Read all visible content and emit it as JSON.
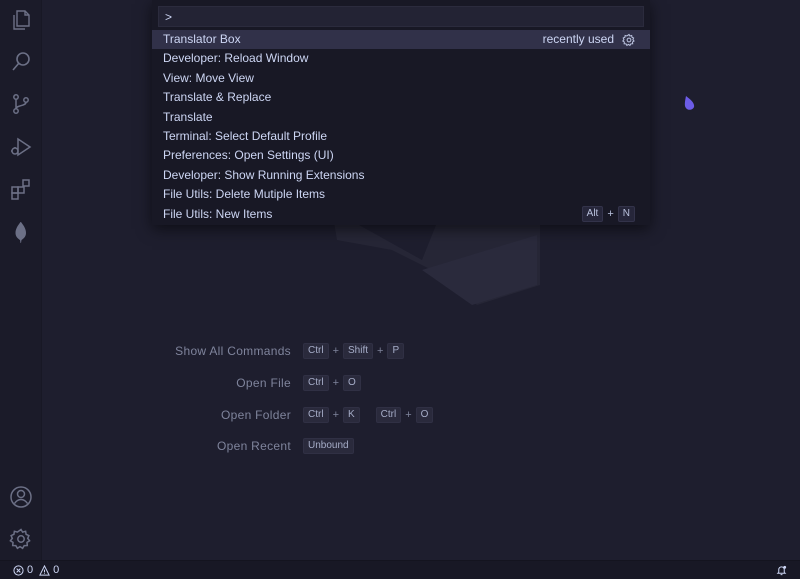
{
  "palette": {
    "input_value": ">",
    "items": [
      {
        "label": "Translator Box",
        "meta": "recently used",
        "selected": true
      },
      {
        "label": "Developer: Reload Window"
      },
      {
        "label": "View: Move View"
      },
      {
        "label": "Translate & Replace"
      },
      {
        "label": "Translate"
      },
      {
        "label": "Terminal: Select Default Profile"
      },
      {
        "label": "Preferences: Open Settings (UI)"
      },
      {
        "label": "Developer: Show Running Extensions"
      },
      {
        "label": "File Utils: Delete Mutiple Items"
      },
      {
        "label": "File Utils: New Items",
        "keys": [
          "Alt",
          "+",
          "N"
        ]
      }
    ]
  },
  "shortcuts": [
    {
      "label": "Show All Commands",
      "keys": [
        "Ctrl",
        "+",
        "Shift",
        "+",
        "P"
      ]
    },
    {
      "label": "Open File",
      "keys": [
        "Ctrl",
        "+",
        "O"
      ]
    },
    {
      "label": "Open Folder",
      "keys": [
        "Ctrl",
        "+",
        "K"
      ],
      "keys2": [
        "Ctrl",
        "+",
        "O"
      ]
    },
    {
      "label": "Open Recent",
      "keys": [
        "Unbound"
      ]
    }
  ],
  "status": {
    "errors": "0",
    "warnings": "0"
  },
  "activity_icons": [
    "explorer-icon",
    "search-icon",
    "source-control-icon",
    "run-debug-icon",
    "extensions-icon",
    "mongodb-leaf-icon"
  ],
  "colors": {
    "background": "#1e1e2e",
    "palette_bg": "#181825",
    "selected_row": "#313149",
    "accent_drop": "#6c5ce7"
  }
}
